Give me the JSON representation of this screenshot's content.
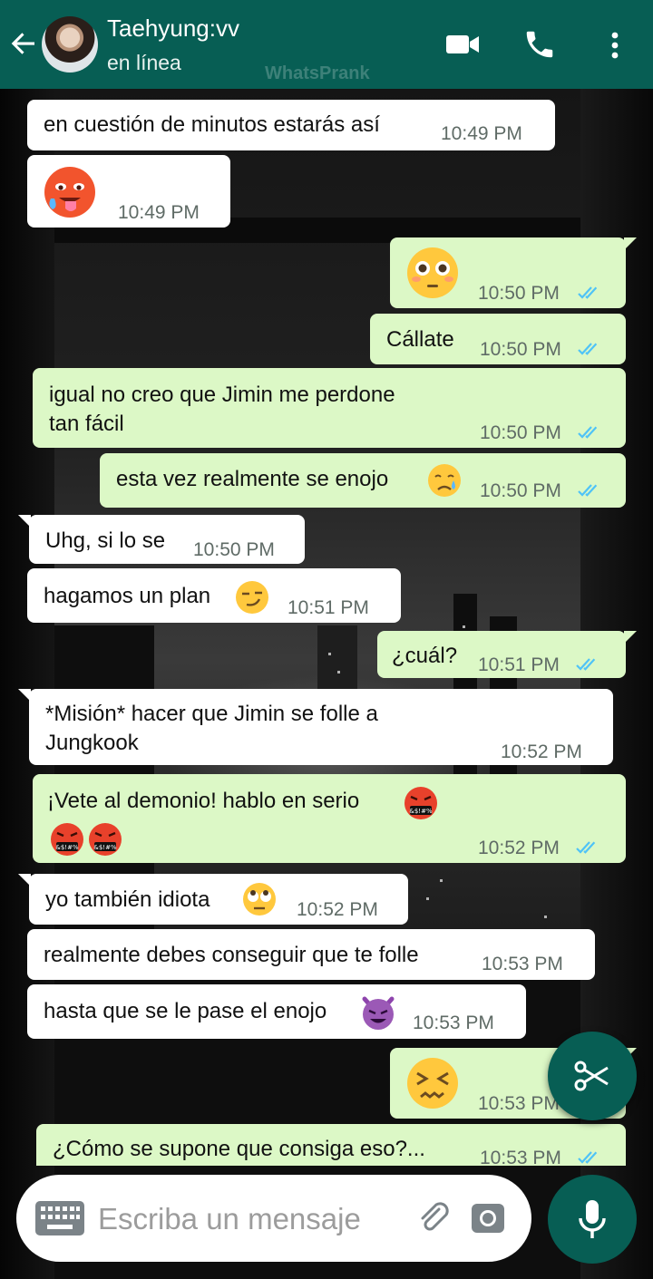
{
  "header": {
    "contact_name": "Taehyung:vv",
    "status": "en línea",
    "watermark": "WhatsPrank"
  },
  "messages": [
    {
      "dir": "in",
      "text": "en cuestión de minutos estarás así",
      "time": "10:49 PM"
    },
    {
      "dir": "in",
      "emoji": "hot-face",
      "time": "10:49 PM"
    },
    {
      "dir": "out",
      "emoji": "flushed-face",
      "time": "10:50 PM",
      "read": true
    },
    {
      "dir": "out",
      "text": "Cállate",
      "time": "10:50 PM",
      "read": true
    },
    {
      "dir": "out",
      "text_line1": "igual no creo que Jimin me perdone",
      "text_line2": "tan fácil",
      "time": "10:50 PM",
      "read": true
    },
    {
      "dir": "out",
      "text": "esta vez realmente se enojo",
      "emoji": "crying-face",
      "time": "10:50 PM",
      "read": true
    },
    {
      "dir": "in",
      "text": "Uhg, si lo se",
      "time": "10:50 PM"
    },
    {
      "dir": "in",
      "text": "hagamos un plan",
      "emoji": "smirking-face",
      "time": "10:51 PM"
    },
    {
      "dir": "out",
      "text": "¿cuál?",
      "time": "10:51 PM",
      "read": true
    },
    {
      "dir": "in",
      "text_line1": "*Misión* hacer que Jimin se folle a",
      "text_line2": "Jungkook",
      "time": "10:52 PM"
    },
    {
      "dir": "out",
      "text": "¡Vete al demonio! hablo en serio",
      "emoji": "face-with-symbols",
      "time": "10:52 PM",
      "read": true
    },
    {
      "dir": "in",
      "text": "yo también idiota",
      "emoji": "eye-roll-face",
      "time": "10:52 PM"
    },
    {
      "dir": "in",
      "text": "realmente debes conseguir que te folle",
      "time": "10:53 PM"
    },
    {
      "dir": "in",
      "text": "hasta que se le pase el enojo",
      "emoji": "smiling-devil",
      "time": "10:53 PM"
    },
    {
      "dir": "out",
      "emoji": "confounded-face",
      "time": "10:53 PM",
      "read": true
    },
    {
      "dir": "out",
      "text": "¿Cómo se supone que consiga eso?...",
      "time": "10:53 PM",
      "read": true
    }
  ],
  "composer": {
    "placeholder": "Escriba un mensaje"
  },
  "colors": {
    "header": "#075e54",
    "outgoing_bubble": "#dcf8c6",
    "incoming_bubble": "#ffffff",
    "read_ticks": "#4fc3f7"
  }
}
